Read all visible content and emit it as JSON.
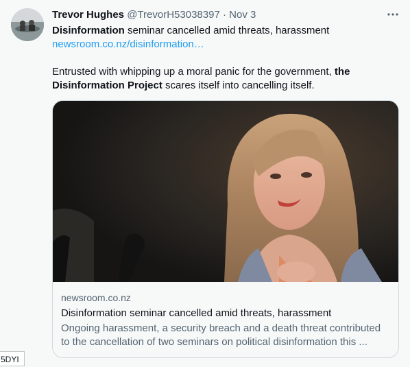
{
  "tweet": {
    "author_name": "Trevor Hughes",
    "handle": "@TrevorH53038397",
    "separator": "·",
    "date": "Nov 3",
    "more_icon": "more-horizontal-icon",
    "line1_bold": "Disinformation",
    "line1_rest": " seminar cancelled amid threats, harassment",
    "link_text": "newsroom.co.nz/disinformation…",
    "body_line1": "Entrusted with whipping up a moral panic for the government,  ",
    "body_line1_bold": "the",
    "body_line2_bold": "Disinformation Project",
    "body_line2_rest": " scares itself into cancelling itself."
  },
  "card": {
    "domain": "newsroom.co.nz",
    "title": "Disinformation seminar cancelled amid threats, harassment",
    "description_line1": "Ongoing harassment, a security breach and a death threat contributed",
    "description_line2": "to the cancellation of two seminars on political disinformation this ..."
  },
  "corner_label": "5DYI",
  "colors": {
    "link": "#1d9bf0",
    "text": "#0f1419",
    "secondary": "#536471",
    "background": "#f7f9f9",
    "border": "#cfd9de"
  }
}
